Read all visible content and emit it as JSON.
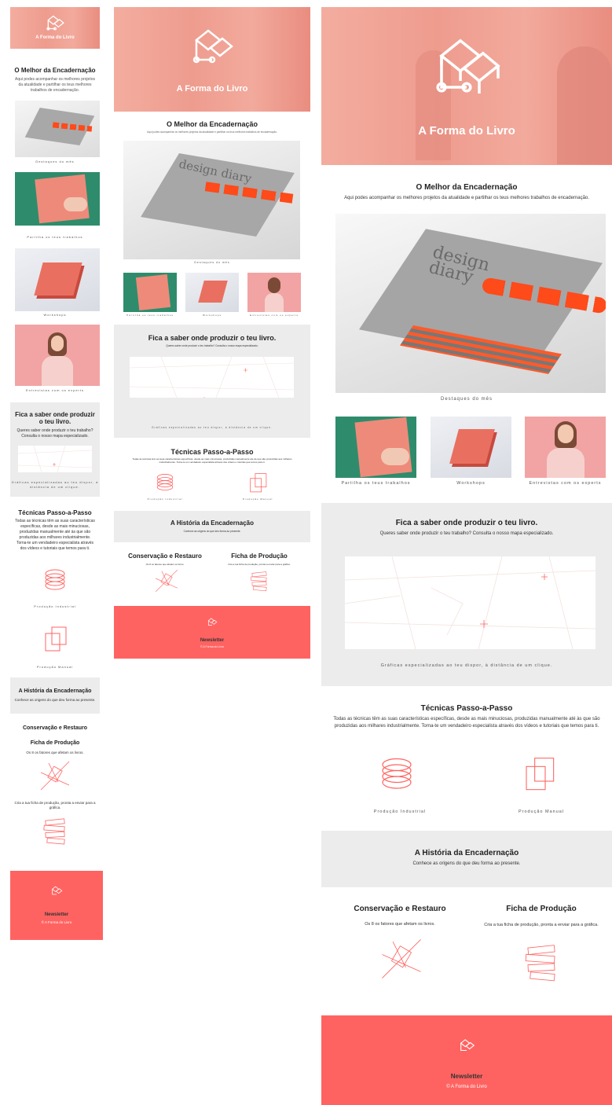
{
  "brand": {
    "name": "A Forma do Livro"
  },
  "featured": {
    "title": "O Melhor da Encadernação",
    "subtitle": "Aqui podes acompanhar os melhores projetos da atualidade e partilhar os teus melhores trabalhos de encadernação.",
    "book_text": "design diary"
  },
  "gallery": {
    "highlight": "Destaques do mês",
    "items": [
      "Partilha os teus trabalhos",
      "Workshops",
      "Entrevistas com os experts"
    ]
  },
  "map_section": {
    "title": "Fica a saber onde produzir o teu livro.",
    "subtitle": "Queres saber onde produzir o teu trabalho? Consulta o nosso mapa especializado.",
    "caption": "Gráficas especializadas ao teu dispor, à distância de um clique."
  },
  "techniques": {
    "title": "Técnicas Passo-a-Passo",
    "text": "Todas as técnicas têm as suas características específicas, desde as mais minuciosas, produzidas manualmente até às que são produzidas aos milhares industrialmente. Torna-te um vendadeiro especialista através dos vídeos e tutoriais que temos para ti.",
    "items": [
      "Produção Industrial",
      "Produção Manual"
    ]
  },
  "history": {
    "title": "A História da Encadernação",
    "subtitle": "Conhece as origens do que deu forma ao presente."
  },
  "cards": {
    "restoration": {
      "title": "Conservação e Restauro",
      "text": "Os 8 os fatores que afetam os livros."
    },
    "production": {
      "title": "Ficha de Produção",
      "text": "Cria a tua ficha de produção, pronta a enviar para a gráfica."
    }
  },
  "footer": {
    "newsletter": "Newsletter",
    "copyright": "© A Forma do Livro"
  },
  "colors": {
    "accent": "#ff6361",
    "hero": "#f0a396",
    "gray": "#ececec"
  }
}
